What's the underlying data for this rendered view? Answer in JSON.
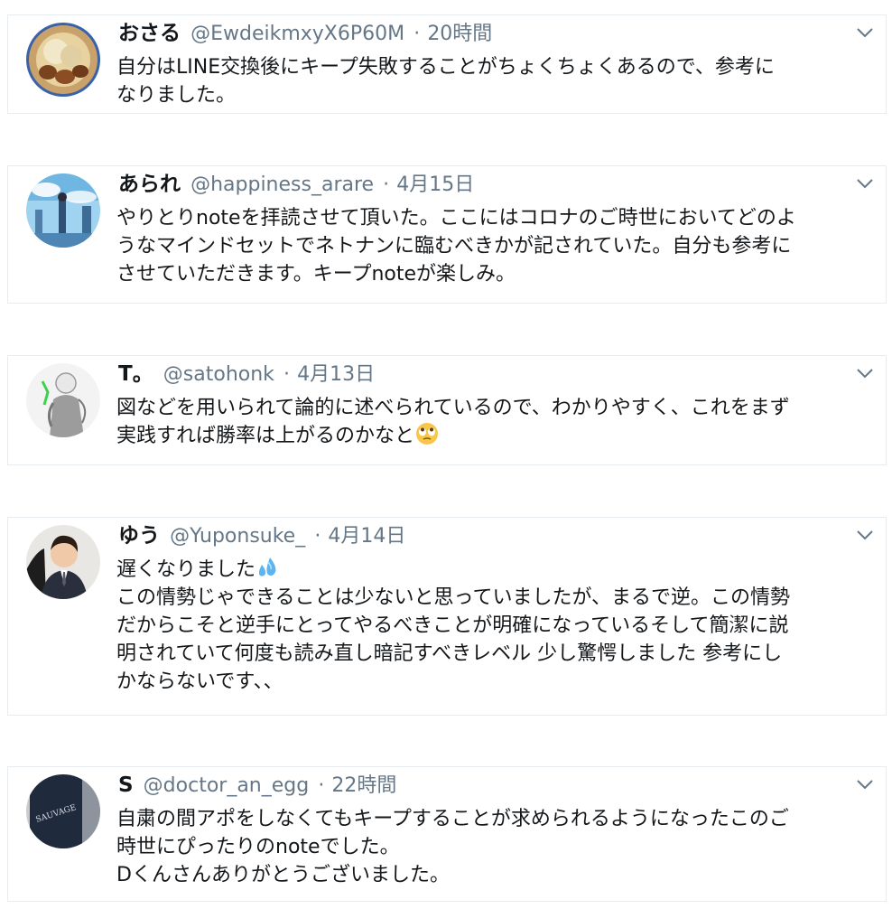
{
  "tweets": [
    {
      "name": "おさる",
      "handle": "@EwdeikmxyX6P60M",
      "separator": "·",
      "time": "20時間",
      "avatar_icon": "food-avatar",
      "lines": [
        "自分はLINE交換後にキープ失敗することがちょくちょくあるので、参考に",
        "なりました。"
      ]
    },
    {
      "name": "あられ",
      "handle": "@happiness_arare",
      "separator": "·",
      "time": "4月15日",
      "avatar_icon": "anime-scene-avatar",
      "lines": [
        "やりとりnoteを拝読させて頂いた。ここにはコロナのご時世においてどのよ",
        "うなマインドセットでネトナンに臨むべきかが記されていた。自分も参考に",
        "させていただきます。キープnoteが楽しみ。"
      ]
    },
    {
      "name": "T。",
      "handle": "@satohonk",
      "separator": "·",
      "time": "4月13日",
      "avatar_icon": "sketch-character-avatar",
      "lines": [
        "図などを用いられて論的に述べられているので、わかりやすく、これをまず",
        "実践すれば勝率は上がるのかなと"
      ],
      "trailing_emoji": "rolling-eyes-emoji"
    },
    {
      "name": "ゆう",
      "handle": "@Yuponsuke_",
      "separator": "·",
      "time": "4月14日",
      "avatar_icon": "man-in-suit-avatar",
      "first_line": "遅くなりました",
      "first_line_emoji": "sweat-droplets-emoji",
      "lines": [
        "この情勢じゃできることは少ないと思っていましたが、まるで逆。この情勢",
        "だからこそと逆手にとってやるべきことが明確になっているそして簡潔に説",
        "明されていて何度も読み直し暗記すべきレベル 少し驚愕しました 参考にし",
        "かならないです、、"
      ]
    },
    {
      "name": "S",
      "handle": "@doctor_an_egg",
      "separator": "·",
      "time": "22時間",
      "avatar_icon": "perfume-bottle-avatar",
      "avatar_text": "SAUVAGE",
      "lines": [
        "自粛の間アポをしなくてもキープすることが求められるようになったこのご",
        "時世にぴったりのnoteでした。",
        "Dくんさんありがとうございました。"
      ]
    }
  ],
  "colors": {
    "text": "#14171a",
    "secondary": "#657786",
    "border": "#e6ecf0"
  }
}
